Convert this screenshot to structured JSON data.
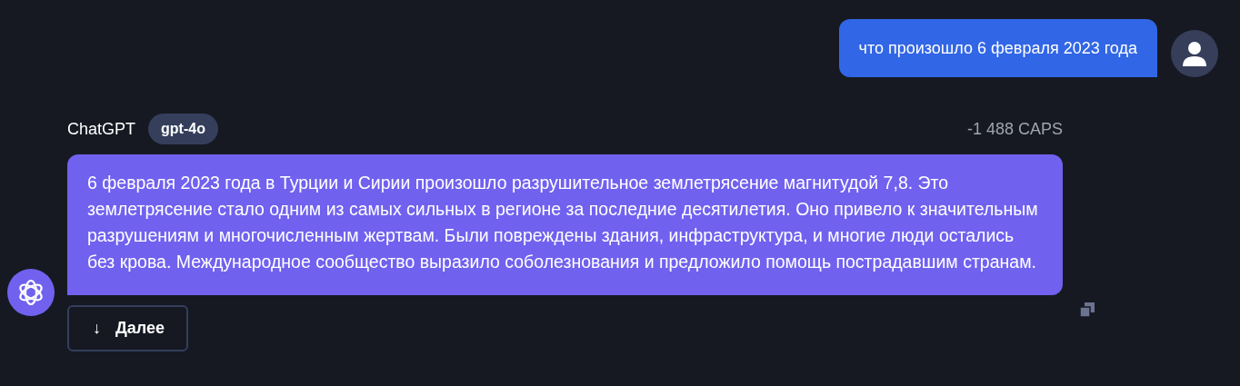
{
  "messages": [
    {
      "kind": "user",
      "text": "что произошло 6 февраля 2023 года"
    },
    {
      "kind": "assistant",
      "author": "ChatGPT",
      "model": "gpt-4o",
      "cost": "-1 488 CAPS",
      "text": "6 февраля 2023 года в Турции и Сирии произошло разрушительное землетрясение магнитудой 7,8. Это землетрясение стало одним из самых сильных в регионе за последние десятилетия. Оно привело к значительным разрушениям и многочисленным жертвам. Были повреждены здания, инфраструктура, и многие люди остались без крова. Международное сообщество выразило соболезнования и предложило помощь пострадавшим странам."
    }
  ],
  "continue_button": {
    "icon": "↓",
    "label": "Далее"
  }
}
